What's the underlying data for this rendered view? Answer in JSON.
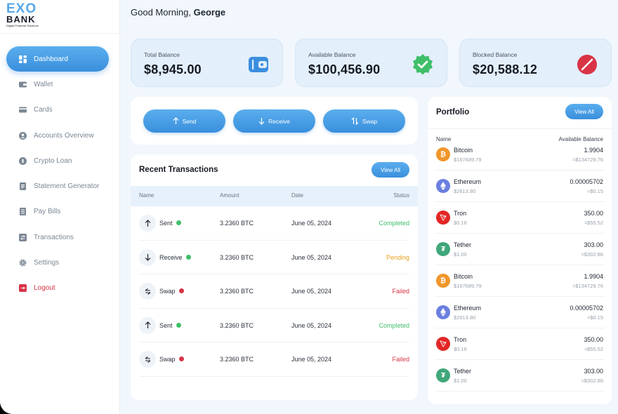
{
  "brand": {
    "name_top": "EXO",
    "name_bottom": "BANK",
    "tagline": "Digital Financial Solutions"
  },
  "header": {
    "greeting": "Good Morning, ",
    "user": "George"
  },
  "sidebar": {
    "items": [
      {
        "label": "Dashboard",
        "icon": "dashboard-icon"
      },
      {
        "label": "Wallet",
        "icon": "wallet-icon"
      },
      {
        "label": "Cards",
        "icon": "card-icon"
      },
      {
        "label": "Accounts Overview",
        "icon": "user-icon"
      },
      {
        "label": "Crypto Loan",
        "icon": "coin-icon"
      },
      {
        "label": "Statement Generator",
        "icon": "document-icon"
      },
      {
        "label": "Pay Bills",
        "icon": "bill-icon"
      },
      {
        "label": "Transactions",
        "icon": "transactions-icon"
      },
      {
        "label": "Settings",
        "icon": "gear-icon"
      },
      {
        "label": "Logout",
        "icon": "logout-icon"
      }
    ]
  },
  "balances": {
    "total": {
      "label": "Total Balance",
      "value": "$8,945.00"
    },
    "available": {
      "label": "Available Balance",
      "value": "$100,456.90"
    },
    "blocked": {
      "label": "Blocked Balance",
      "value": "$20,588.12"
    }
  },
  "actions": {
    "send": "Send",
    "receive": "Receive",
    "swap": "Swap"
  },
  "transactions": {
    "title": "Recent Transactions",
    "view_all": "View All",
    "columns": {
      "name": "Name",
      "amount": "Amount",
      "date": "Date",
      "status": "Status"
    },
    "rows": [
      {
        "type": "Sent",
        "amount": "3.2360 BTC",
        "date": "June 05, 2024",
        "status": "Completed"
      },
      {
        "type": "Receive",
        "amount": "3.2360 BTC",
        "date": "June 05, 2024",
        "status": "Pending"
      },
      {
        "type": "Swap",
        "amount": "3.2360 BTC",
        "date": "June 05, 2024",
        "status": "Failed"
      },
      {
        "type": "Sent",
        "amount": "3.2360 BTC",
        "date": "June 05, 2024",
        "status": "Completed"
      },
      {
        "type": "Swap",
        "amount": "3.2360 BTC",
        "date": "June 05, 2024",
        "status": "Failed"
      }
    ]
  },
  "portfolio": {
    "title": "Portfolio",
    "view_all": "View All",
    "columns": {
      "name": "Name",
      "balance": "Available Balance"
    },
    "rows": [
      {
        "coin": "Bitcoin",
        "price": "$167689.79",
        "amount": "1.9904",
        "usd": "≈$134729.76"
      },
      {
        "coin": "Ethereum",
        "price": "$2613.80",
        "amount": "0.00005702",
        "usd": "≈$0.15"
      },
      {
        "coin": "Tron",
        "price": "$0.16",
        "amount": "350.00",
        "usd": "≈$55.52"
      },
      {
        "coin": "Tether",
        "price": "$1.00",
        "amount": "303.00",
        "usd": "≈$302.86"
      },
      {
        "coin": "Bitcoin",
        "price": "$167689.79",
        "amount": "1.9904",
        "usd": "≈$134729.76"
      },
      {
        "coin": "Ethereum",
        "price": "$2613.80",
        "amount": "0.00005702",
        "usd": "≈$0.15"
      },
      {
        "coin": "Tron",
        "price": "$0.16",
        "amount": "350.00",
        "usd": "≈$55.52"
      },
      {
        "coin": "Tether",
        "price": "$1.00",
        "amount": "303.00",
        "usd": "≈$302.86"
      }
    ]
  },
  "colors": {
    "accent": "#3f93dd",
    "completed": "#3fbf6a",
    "pending": "#e8a020",
    "failed": "#d83446",
    "bitcoin": "#f0962b",
    "ethereum": "#6b7fe0",
    "tron": "#e32626",
    "tether": "#3fa77a"
  }
}
